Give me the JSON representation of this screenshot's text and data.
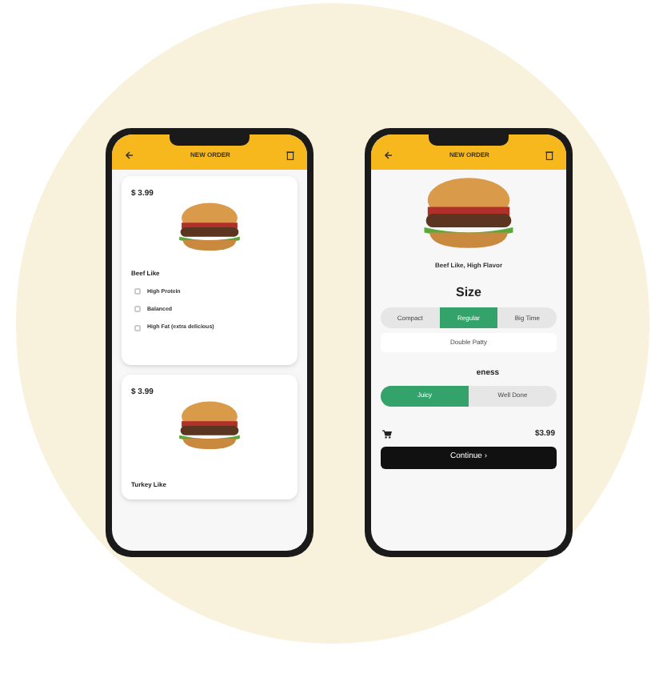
{
  "phones": [
    {
      "kind": "list",
      "header": {
        "title": "NEW ORDER"
      },
      "cards": [
        {
          "price": "$ 3.99",
          "name": "Beef Like",
          "options": [
            {
              "label": "High Protein",
              "checked": false
            },
            {
              "label": "Balanced",
              "checked": false
            },
            {
              "label": "High Fat (extra delicious)",
              "checked": false
            }
          ]
        },
        {
          "price": "$ 3.99",
          "name": "Turkey Like"
        }
      ]
    },
    {
      "kind": "detail",
      "header": {
        "title": "NEW ORDER"
      },
      "product": "Beef Like, High Flavor",
      "size_title": "Size",
      "sizes": [
        {
          "label": "Compact",
          "selected": false
        },
        {
          "label": "Regular",
          "selected": true
        },
        {
          "label": "Big Time",
          "selected": false
        }
      ],
      "extra": "Double Patty",
      "doneness_title": "eness",
      "doneness": [
        {
          "label": "Juicy",
          "selected": true
        },
        {
          "label": "Well Done",
          "selected": false
        }
      ],
      "total": "$3.99",
      "button": "Continue ›"
    }
  ]
}
